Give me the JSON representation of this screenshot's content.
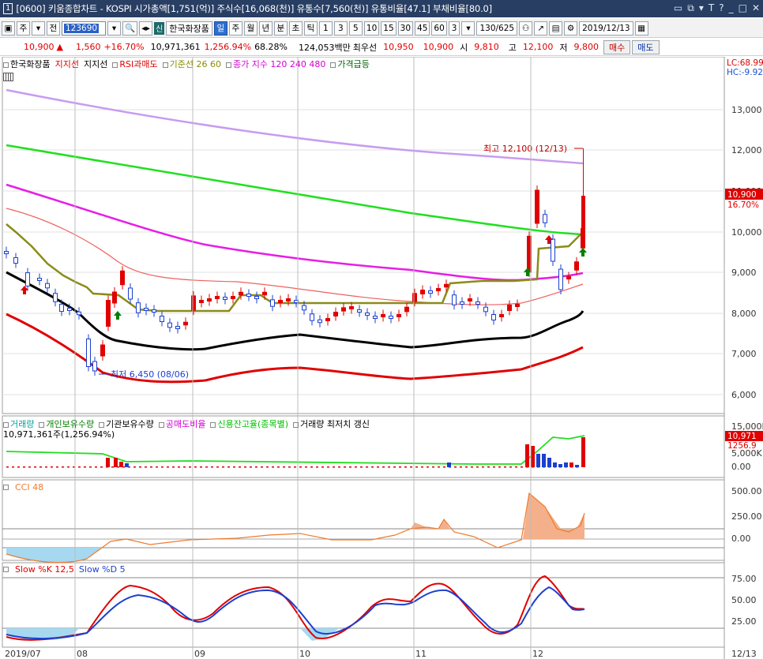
{
  "window": {
    "title": "[0600] 키움종합차트 - KOSPI 시가총액[1,751(억)] 주식수[16,068(천)] 유통수[7,560(천)] 유통비율[47.1] 부채비율[80.0]",
    "app_number": "1",
    "buttons": [
      "▭",
      "⧉",
      "▾",
      "T",
      "?",
      "_",
      "□",
      "✕"
    ]
  },
  "toolbar": {
    "period_select": "주",
    "prev_select": "전",
    "stock_code": "123690",
    "sin_badge": "신",
    "stock_name": "한국화장품",
    "period_tabs": [
      "일",
      "주",
      "월",
      "년",
      "분",
      "초",
      "틱"
    ],
    "active_period": "일",
    "intervals": [
      "1",
      "3",
      "5",
      "10",
      "15",
      "30",
      "45",
      "60"
    ],
    "custom_interval": "3",
    "count": "130",
    "total": "/625",
    "date": "2019/12/13"
  },
  "quote": {
    "price": "10,900",
    "change_arrow": "▲",
    "change": "1,560",
    "change_pct": "+16.70%",
    "volume": "10,971,361",
    "volume_ratio": "1,256.94%",
    "turnover": "68.28%",
    "amount": "124,053백만",
    "ask_label": "최우선",
    "ask": "10,950",
    "bid": "10,900",
    "open_label": "시",
    "open": "9,810",
    "high_label": "고",
    "high": "12,100",
    "low_label": "저",
    "low": "9,800",
    "buy_label": "매수",
    "sell_label": "매도"
  },
  "main_panel": {
    "legend": [
      {
        "text": "한국화장품",
        "color": "#000000"
      },
      {
        "text": "지지선",
        "color": "#e00000"
      },
      {
        "text": "지지선",
        "color": "#000000"
      },
      {
        "text": "RSI과매도",
        "color": "#e00000"
      },
      {
        "text": "기준선 26 60",
        "color": "#8b8b00"
      },
      {
        "text": "종가 지수 120 240 480",
        "color": "#d400d4"
      },
      {
        "text": "가격급등",
        "color": "#006400"
      }
    ],
    "lc_label": "LC:68.99",
    "hc_label": "HC:-9.92",
    "high_annotation": "최고 12,100 (12/13)",
    "low_annotation": "최저 6,450 (08/06)",
    "price_tag": "10,900",
    "price_tag_pct": "16.70%",
    "y_ticks": [
      "13,000",
      "12,000",
      "11,000",
      "10,000",
      "9,000",
      "8,000",
      "7,000",
      "6,000"
    ]
  },
  "volume_panel": {
    "legend": [
      {
        "text": "거래량",
        "color": "#00a0a0"
      },
      {
        "text": "개인보유수량",
        "color": "#008000"
      },
      {
        "text": "기관보유수량",
        "color": "#000000"
      },
      {
        "text": "공매도비율",
        "color": "#d400d4"
      },
      {
        "text": "신용잔고율(종목별)",
        "color": "#00c000"
      },
      {
        "text": "거래량 최저치 갱신",
        "color": "#000000"
      }
    ],
    "sub_label": "10,971,361주(1,256.94%)",
    "y_ticks": [
      "15,000K",
      "5,000K",
      "0.00"
    ],
    "tag_value": "10,971",
    "tag_pct": "1256.9"
  },
  "cci_panel": {
    "legend": "CCI 48",
    "y_ticks": [
      "500.00",
      "250.00",
      "0.00"
    ]
  },
  "stoch_panel": {
    "legend_k": "Slow %K 12,5",
    "legend_d": "Slow %D 5",
    "y_ticks": [
      "75.00",
      "50.00",
      "25.00"
    ]
  },
  "x_axis": {
    "labels": [
      "2019/07",
      "08",
      "09",
      "10",
      "11",
      "12"
    ],
    "right_label": "12/13"
  }
}
